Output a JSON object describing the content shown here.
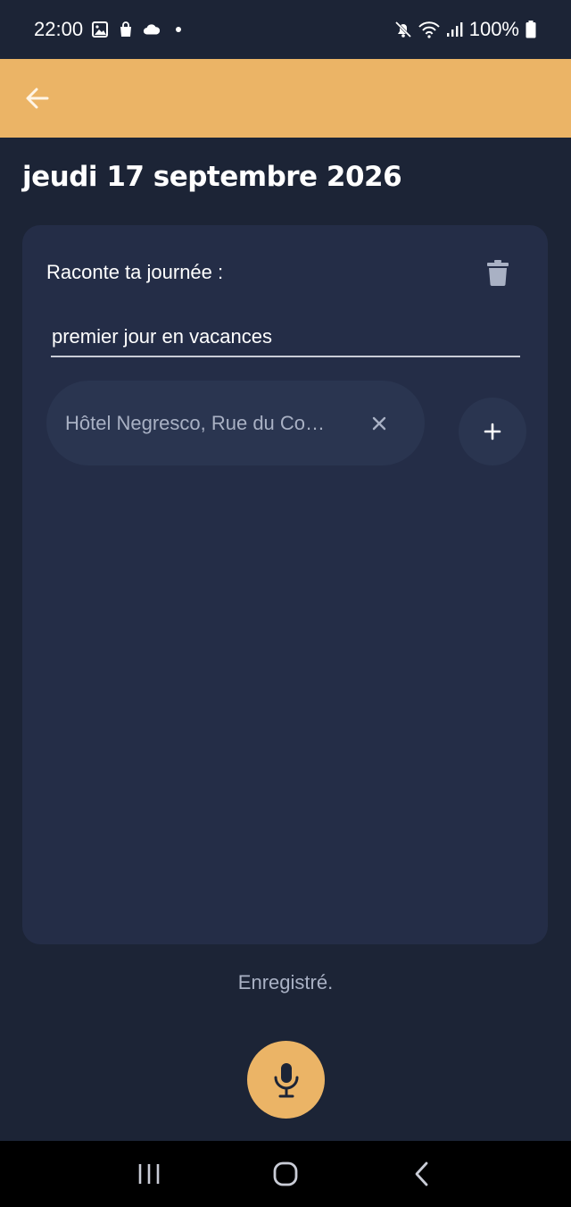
{
  "status_bar": {
    "time": "22:00",
    "battery_text": "100%",
    "left_icons": [
      "image-icon",
      "shopping-bag-icon",
      "cloud-icon",
      "dot-icon"
    ],
    "right_icons": [
      "mute-icon",
      "wifi-icon",
      "signal-icon",
      "battery-icon"
    ]
  },
  "app_bar": {
    "back_icon": "arrow-left-icon",
    "color": "#ebb466"
  },
  "page": {
    "title": "jeudi 17 septembre 2026"
  },
  "card": {
    "prompt": "Raconte ta journée :",
    "delete_icon": "trash-icon",
    "entry_value": "premier jour en vacances",
    "location_chip": {
      "label": "Hôtel Negresco, Rue du Co…",
      "remove_icon": "close-icon"
    },
    "add_icon": "plus-icon"
  },
  "footer": {
    "status_text": "Enregistré.",
    "mic_icon": "microphone-icon"
  },
  "nav_bar": {
    "icons": [
      "recent-apps-icon",
      "home-icon",
      "back-icon"
    ]
  },
  "colors": {
    "background": "#1c2436",
    "card": "#242d47",
    "chip": "#2a3550",
    "accent": "#ebb466",
    "muted_text": "#a9b1c4"
  }
}
